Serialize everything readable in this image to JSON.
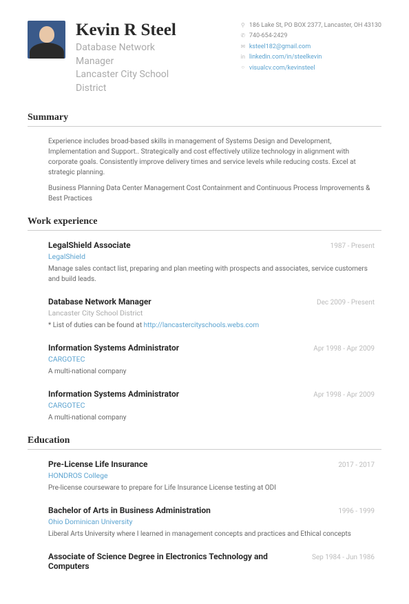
{
  "header": {
    "name": "Kevin R Steel",
    "title": "Database Network Manager",
    "company": "Lancaster City School District"
  },
  "contact": {
    "address": "186 Lake St, PO BOX 2377, Lancaster, OH 43130",
    "phone": "740-654-2429",
    "email": "ksteel182@gmail.com",
    "linkedin": "linkedin.com/in/steelkevin",
    "visualcv": "visualcv.com/kevinsteel"
  },
  "sections": {
    "summary_title": "Summary",
    "work_title": "Work experience",
    "education_title": "Education"
  },
  "summary": {
    "p1": "Experience includes broad-based skills in management of Systems Design and Development, Implementation and Support.. Strategically and cost effectively utilize technology in alignment with corporate goals. Consistently improve delivery times and service levels while reducing costs. Excel at strategic planning.",
    "p2": "Business Planning Data Center Management Cost Containment and Continuous Process Improvements & Best Practices"
  },
  "jobs": [
    {
      "title": "LegalShield Associate",
      "dates": "1987 - Present",
      "company": "LegalShield",
      "company_link": true,
      "desc": "Manage sales contact list, preparing and plan meeting with prospects and associates, service customers and build leads."
    },
    {
      "title": "Database Network Manager",
      "dates": "Dec 2009 - Present",
      "company": "Lancaster City School District",
      "company_link": false,
      "desc_prefix": "* List of duties can be found at ",
      "desc_link": "http://lancastercityschools.webs.com"
    },
    {
      "title": "Information Systems Administrator",
      "dates": "Apr 1998 - Apr 2009",
      "company": "CARGOTEC",
      "company_link": true,
      "desc": "A multi-national company"
    },
    {
      "title": "Information Systems Administrator",
      "dates": "Apr 1998 - Apr 2009",
      "company": "CARGOTEC",
      "company_link": true,
      "desc": "A multi-national company"
    }
  ],
  "education": [
    {
      "title": "Pre-License Life Insurance",
      "dates": "2017 - 2017",
      "school": "HONDROS College",
      "desc": "Pre-license courseware to prepare for Life Insurance License testing at ODI"
    },
    {
      "title": "Bachelor of Arts in Business Administration",
      "dates": "1996 - 1999",
      "school": "Ohio Dominican University",
      "desc": "Liberal Arts University where I learned in management concepts and practices and Ethical concepts"
    },
    {
      "title": "Associate of Science Degree in Electronics Technology and Computers",
      "dates": "Sep 1984 - Jun 1986",
      "school": "",
      "desc": ""
    }
  ]
}
